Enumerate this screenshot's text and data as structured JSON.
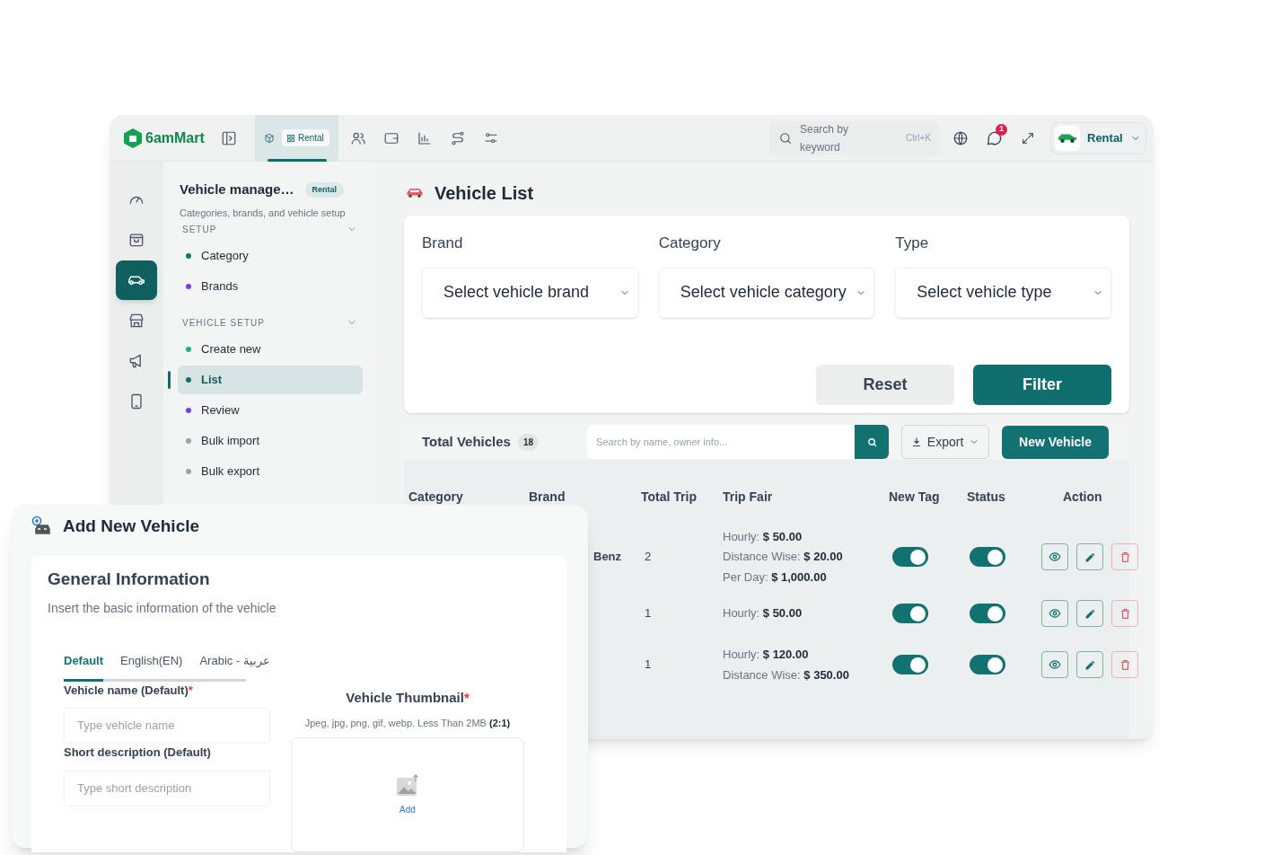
{
  "topbar": {
    "logo": "6amMart",
    "module_tab": {
      "label": "Rental",
      "selected": true
    },
    "search": {
      "placeholder": "Search by keyword",
      "shortcut": "Ctrl+K"
    },
    "notification_count": "1",
    "module_switcher": "Rental"
  },
  "rail": [
    {
      "kind": "gauge",
      "selected": false
    },
    {
      "kind": "bag",
      "selected": false
    },
    {
      "kind": "car",
      "selected": true
    },
    {
      "kind": "store",
      "selected": false
    },
    {
      "kind": "megaphone",
      "selected": false
    },
    {
      "kind": "phone",
      "selected": false
    }
  ],
  "sidebar": {
    "title": "Vehicle manage…",
    "badge": "Rental",
    "subtitle": "Categories, brands, and vehicle setup",
    "sections": [
      {
        "title": "SETUP",
        "expanded": true,
        "items": [
          {
            "label": "Category",
            "color": "#0f766e",
            "selected": false
          },
          {
            "label": "Brands",
            "color": "#7c3aed",
            "selected": false
          }
        ]
      },
      {
        "title": "VEHICLE SETUP",
        "expanded": true,
        "items": [
          {
            "label": "Create new",
            "color": "#10b981",
            "selected": false
          },
          {
            "label": "List",
            "color": "#0f766e",
            "selected": true
          },
          {
            "label": "Review",
            "color": "#7c3aed",
            "selected": false
          },
          {
            "label": "Bulk import",
            "color": "#9ca3af",
            "selected": false
          },
          {
            "label": "Bulk export",
            "color": "#9ca3af",
            "selected": false
          }
        ]
      }
    ]
  },
  "page_title": "Vehicle List",
  "filters": [
    {
      "label": "Brand",
      "placeholder": "Select vehicle brand"
    },
    {
      "label": "Category",
      "placeholder": "Select vehicle category"
    },
    {
      "label": "Type",
      "placeholder": "Select vehicle type"
    }
  ],
  "filter_buttons": [
    "Reset",
    "Filter"
  ],
  "table": {
    "title": "Total Vehicles",
    "count": "18",
    "search_placeholder": "Search by name, owner info...",
    "export": "Export",
    "new_button": "New Vehicle",
    "columns": [
      "Category",
      "Brand",
      "Total Trip",
      "Trip Fair",
      "New Tag",
      "Status",
      "Action"
    ],
    "rows": [
      {
        "brand": "Benz",
        "total_trip": "2",
        "trip_fair": [
          "Hourly: **$ 50.00**",
          "Distance Wise: **$ 20.00**",
          "Per Day: **$ 1,000.00**"
        ],
        "new_tag": true,
        "status": true
      },
      {
        "total_trip": "1",
        "trip_fair": [
          "Hourly: **$ 50.00**"
        ],
        "new_tag": true,
        "status": true
      },
      {
        "total_trip": "1",
        "trip_fair": [
          "Hourly: **$ 120.00**",
          "Distance Wise: **$ 350.00**"
        ],
        "new_tag": true,
        "status": true
      }
    ]
  },
  "add_panel": {
    "title": "Add New Vehicle",
    "section_title": "General Information",
    "section_subtitle": "Insert the basic information of the vehicle",
    "language_tabs": [
      {
        "label": "Default",
        "selected": true
      },
      {
        "label": "English(EN)",
        "selected": false
      },
      {
        "label": "Arabic - عربية",
        "selected": false
      }
    ],
    "fields": [
      {
        "label": "Vehicle name (Default)",
        "required_mark": "*",
        "placeholder": "Type vehicle name"
      },
      {
        "label": "Short description (Default)",
        "placeholder": "Type short description"
      }
    ],
    "thumbnail": {
      "title": "Vehicle Thumbnail",
      "required_mark": "*",
      "hint": "Jpeg, jpg, png, gif, webp. Less Than 2MB **(2:1)**",
      "upload_label": "Add"
    }
  }
}
